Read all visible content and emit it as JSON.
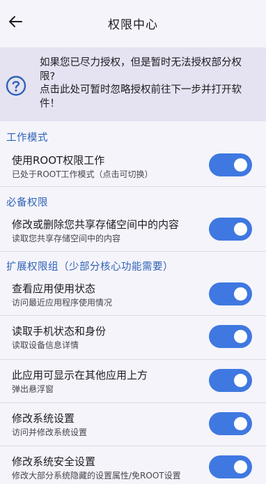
{
  "app_bar": {
    "title": "权限中心",
    "back_icon": "arrow-left-icon"
  },
  "notice": {
    "icon": "help-circle-icon",
    "line1": "如果您已尽力授权，但是暂时无法授权部分权",
    "line2": "限?",
    "line3": "点击此处可暂时忽略授权前往下一步并打开软",
    "line4": "件！"
  },
  "sections": {
    "work_mode": "工作模式",
    "required": "必备权限",
    "extended": "扩展权限组（少部分核心功能需要）"
  },
  "items": [
    {
      "title": "使用ROOT权限工作",
      "subtitle": "已处于ROOT工作模式（点击可切换）",
      "enabled": true
    },
    {
      "title": "修改或删除您共享存储空间中的内容",
      "subtitle": "读取您共享存储空间中的内容",
      "enabled": true
    },
    {
      "title": "查看应用使用状态",
      "subtitle": "访问最近应用程序使用情况",
      "enabled": true
    },
    {
      "title": "读取手机状态和身份",
      "subtitle": "读取设备信息详情",
      "enabled": true
    },
    {
      "title": "此应用可显示在其他应用上方",
      "subtitle": "弹出悬浮窗",
      "enabled": true
    },
    {
      "title": "修改系统设置",
      "subtitle": "访问并修改系统设置",
      "enabled": true
    },
    {
      "title": "修改系统安全设置",
      "subtitle": "修改大部分系统隐藏的设置属性/免ROOT设置",
      "enabled": true
    }
  ],
  "colors": {
    "accent": "#3f78e0",
    "section": "#2f63b6",
    "notice_bg": "#e5e2f1",
    "page_bg": "#f5f4fb"
  }
}
